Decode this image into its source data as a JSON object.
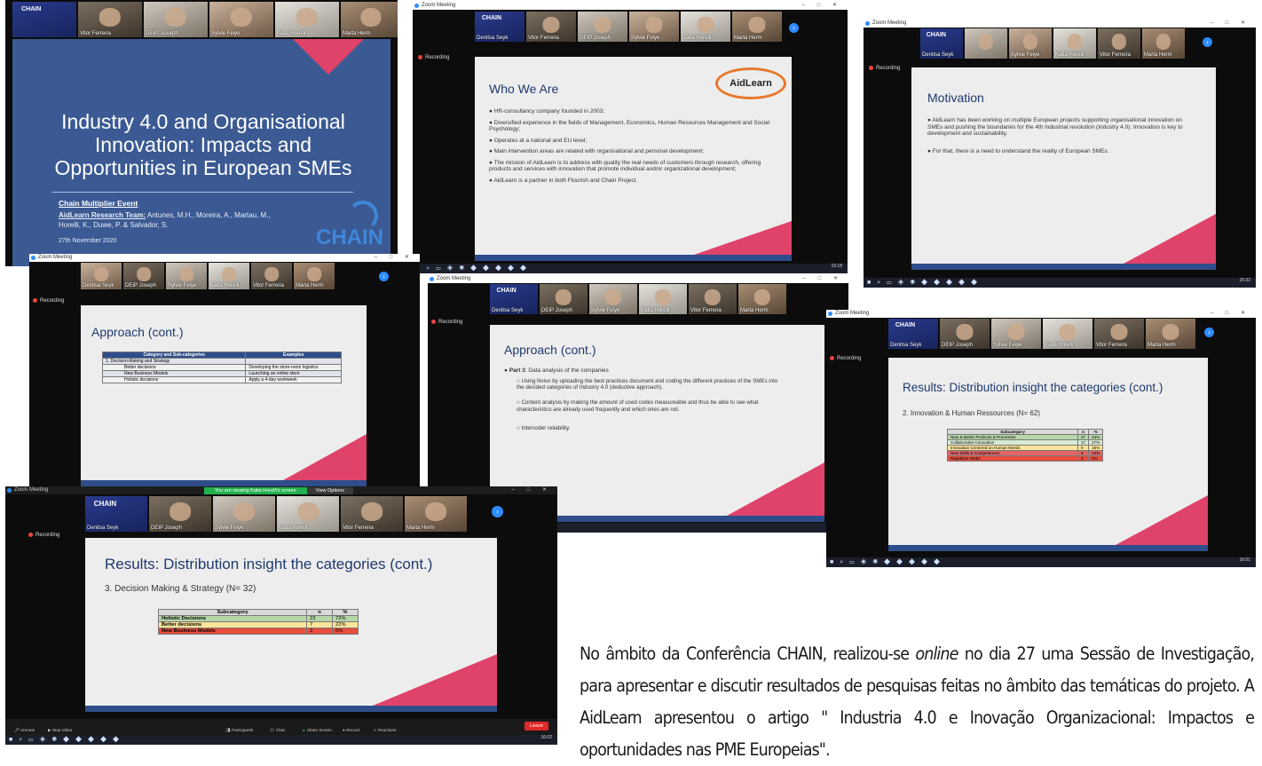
{
  "common": {
    "app_name": "Zoom Meeting",
    "recording": "Recording",
    "window_controls": "–  □  ✕"
  },
  "shot1": {
    "participants": [
      "CHAIN",
      "Vitor Ferreira",
      "DEIP: Joseph",
      "Sylvie Feiye",
      "Katia Horelli",
      "Marta Herm"
    ],
    "title": "Industry 4.0 and Organisational Innovation: Impacts and Opportunities in European SMEs",
    "event": "Chain Multiplier Event",
    "team_label": "AidLearn Research Team:",
    "authors": "Antunes, M.H., Moreira, A., Martau, M., Horelli, K., Duwe, P. & Salvador, S.",
    "date": "27th November 2020",
    "logo": "CHAIN"
  },
  "shot2": {
    "participants": [
      "Denitsa Seyk",
      "Vitor Ferreira",
      "DEIP Joseph",
      "Sylvie Feiye",
      "Katia Horelli",
      "Marta Herm"
    ],
    "title": "Who We Are",
    "logo": "AidLearn",
    "bullets": [
      "HR-consultancy company founded in 2003;",
      "Diversified experience in the fields of Management, Economics, Human Resources Management and Social Psychology;",
      "Operates at a national and EU level;",
      "Main intervention areas are related with organisational and personal development;",
      "The mission of AidLearn is to address with quality the real needs of customers through research, offering products and services with innovation that promote individual and/or organizational development;",
      "AidLearn is a partner in both Flourish and Chain Project."
    ],
    "clock": "15:18"
  },
  "shot3": {
    "participants": [
      "Denitsa Seyk",
      "Sylvie Feiye",
      "Katia Horelli",
      "Vitor Ferreira",
      "Marta Herm"
    ],
    "title": "Motivation",
    "bullets": [
      "AidLearn has been working on multiple European projects supporting organisational innovation on SMEs and pushing the boundaries for the 4th industrial revolution (Industry 4.0). Innovation is key to development and sustainability.",
      "For that, there is a need to understand the reality of European SMEs."
    ],
    "clock": "15:32"
  },
  "shot4": {
    "participants": [
      "Denitsa Seyk",
      "DEIP Joseph",
      "Sylvie Feiye",
      "Katia Horelli",
      "Vitor Ferreira",
      "Marta Herm"
    ],
    "title": "Approach (cont.)",
    "table_headers": [
      "Category and Sub-categories",
      "Examples"
    ],
    "table_rows": [
      [
        "1. Decision-Making and Strategy",
        ""
      ],
      [
        "Better decisions",
        "Developing the store-room logistics"
      ],
      [
        "New Business Models",
        "Launching an online store"
      ],
      [
        "Holistic decisions",
        "Apply a 4-day workweek"
      ]
    ]
  },
  "shot5": {
    "participants": [
      "Denitsa Seyk",
      "DEIP Joseph",
      "Sylvie Feiye",
      "Katia Horelli",
      "Vitor Ferreira",
      "Marta Herm"
    ],
    "title": "Approach (cont.)",
    "part_label": "Part 3",
    "part_text": ": Data analysis of the companies",
    "subs": [
      "Using Nvivo by uploading the best practices document and coding the different practices of the SMEs into the decided categories of Industry 4.0 (deductive approach).",
      "Content analysis by making the amount of used codes measureable and thus be able to see what characteristics are already used frequently and which ones are not.",
      "Intercoder reliability."
    ]
  },
  "shot6": {
    "participants": [
      "Denitsa Seyk",
      "DEIP Joseph",
      "Sylvie Feiye",
      "Katia Horelli",
      "Vitor Ferreira",
      "Marta Herm"
    ],
    "title": "Results: Distribution insight the categories (cont.)",
    "subtitle": "2. Innovation & Human Ressources (N= 62)",
    "table_headers": [
      "Subcategory",
      "n",
      "%"
    ],
    "table_rows": [
      [
        "New & Better Products & Processes",
        "27",
        "44%"
      ],
      [
        "Collaborative Innovation",
        "17",
        "27%"
      ],
      [
        "Innovation Centered on Human Needs",
        "9",
        "15%"
      ],
      [
        "New Skills & Competences",
        "6",
        "10%"
      ],
      [
        "Repetitive Tasks",
        "3",
        "5%"
      ]
    ],
    "row_colors": [
      "#b6d7a8",
      "#d9ead3",
      "#ffe599",
      "#e06666",
      "#e84c3d"
    ],
    "clock": "16:01"
  },
  "shot7": {
    "banner": "You are viewing Katia Horelli's screen",
    "view_options": "View Options",
    "participants": [
      "Denitsa Seyk",
      "DEIP Joseph",
      "Sylvie Feiye",
      "Katia Horelli",
      "Vitor Ferreira",
      "Marta Herm"
    ],
    "title": "Results: Distribution insight the categories (cont.)",
    "subtitle": "3. Decision Making & Strategy (N= 32)",
    "table_headers": [
      "Subcategory",
      "n",
      "%"
    ],
    "table_rows": [
      [
        "Holistic Decisions",
        "23",
        "72%"
      ],
      [
        "Better decisions",
        "7",
        "22%"
      ],
      [
        "New Business Models",
        "2",
        "6%"
      ]
    ],
    "row_colors": [
      "#b6d7a8",
      "#ffe599",
      "#e84c3d"
    ],
    "toolbar": [
      "Unmute",
      "Stop Video",
      "Participants",
      "Chat",
      "Share Screen",
      "Record",
      "Reactions"
    ],
    "leave": "Leave",
    "clock": "16:02"
  },
  "caption": {
    "part1": "No âmbito da Conferência CHAIN, realizou-se ",
    "online": "online",
    "part2": " no dia 27 uma Sessão de Investigação, para apresentar e discutir resultados de pesquisas feitas no âmbito das temáticas do projeto. A AidLearn apresentou o artigo \" Industria 4.0 e Inovação Organizacional: Impactos e oportunidades nas PME Europeias\"."
  },
  "colors": {
    "accent_blue": "#2d8cff",
    "slide_title": "#1e3a6e",
    "slide1_bg": "#3b5a93",
    "pink": "#e0436a",
    "aid_orange": "#e8782d"
  }
}
